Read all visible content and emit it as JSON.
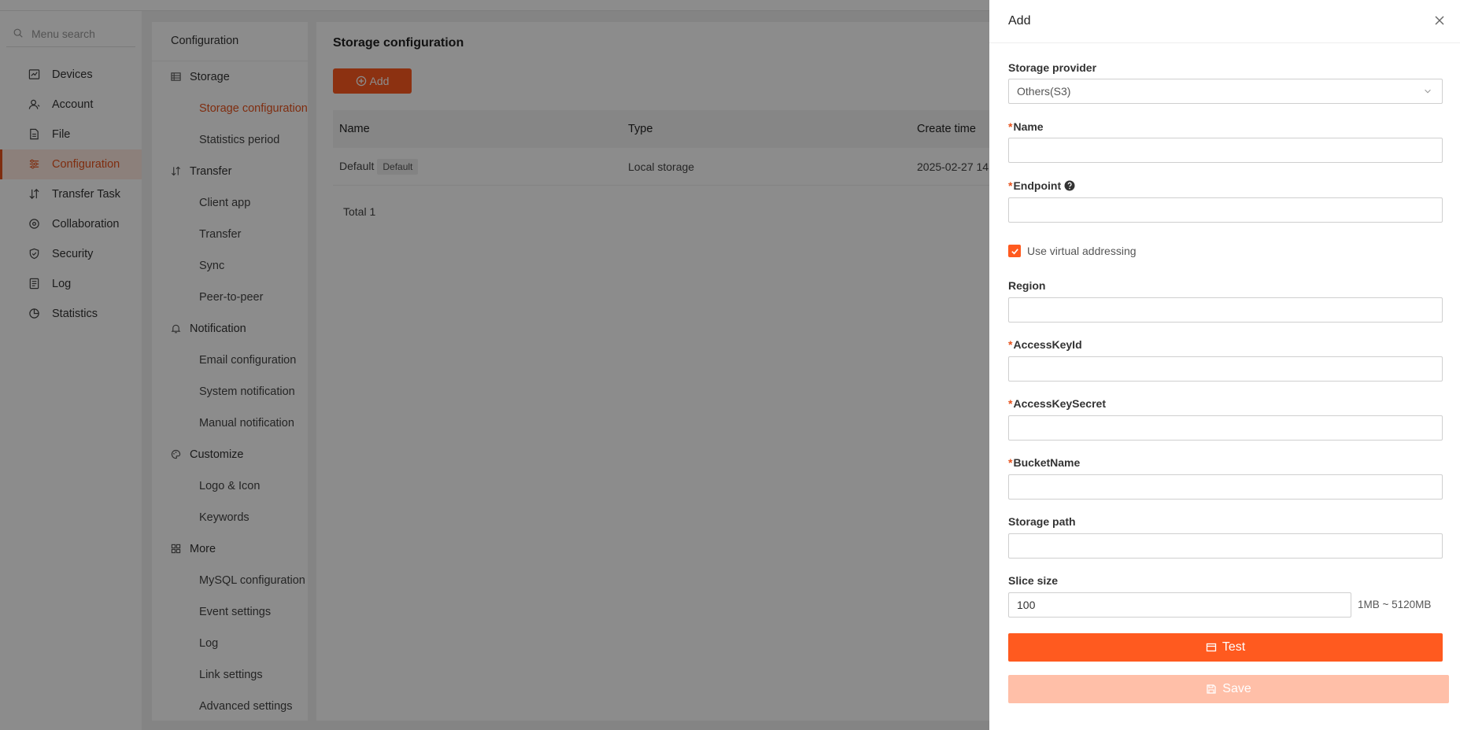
{
  "sidebar": {
    "search_placeholder": "Menu search",
    "items": [
      {
        "label": "Devices",
        "icon": "chart-icon"
      },
      {
        "label": "Account",
        "icon": "user-icon"
      },
      {
        "label": "File",
        "icon": "file-icon"
      },
      {
        "label": "Configuration",
        "icon": "sliders-icon",
        "active": true
      },
      {
        "label": "Transfer Task",
        "icon": "transfer-icon"
      },
      {
        "label": "Collaboration",
        "icon": "collaboration-icon"
      },
      {
        "label": "Security",
        "icon": "shield-icon"
      },
      {
        "label": "Log",
        "icon": "log-icon"
      },
      {
        "label": "Statistics",
        "icon": "pie-icon"
      }
    ]
  },
  "subnav": {
    "title": "Configuration",
    "groups": [
      {
        "label": "Storage",
        "icon": "storage-icon",
        "items": [
          "Storage configuration",
          "Statistics period"
        ]
      },
      {
        "label": "Transfer",
        "icon": "transfer-icon",
        "items": [
          "Client app",
          "Transfer",
          "Sync",
          "Peer-to-peer"
        ]
      },
      {
        "label": "Notification",
        "icon": "bell-icon",
        "items": [
          "Email configuration",
          "System notification",
          "Manual notification"
        ]
      },
      {
        "label": "Customize",
        "icon": "palette-icon",
        "items": [
          "Logo & Icon",
          "Keywords"
        ]
      },
      {
        "label": "More",
        "icon": "grid-icon",
        "items": [
          "MySQL configuration",
          "Event settings",
          "Log",
          "Link settings",
          "Advanced settings"
        ]
      }
    ],
    "active_item": "Storage configuration"
  },
  "content": {
    "title": "Storage configuration",
    "add_label": "Add",
    "columns": [
      "Name",
      "Type",
      "Create time"
    ],
    "rows": [
      {
        "name": "Default",
        "badge": "Default",
        "type": "Local storage",
        "create_time": "2025-02-27 14:"
      }
    ],
    "total": "Total 1"
  },
  "drawer": {
    "title": "Add",
    "storage_provider_label": "Storage provider",
    "storage_provider_value": "Others(S3)",
    "name_label": "Name",
    "endpoint_label": "Endpoint",
    "virtual_addressing_label": "Use virtual addressing",
    "virtual_addressing_checked": true,
    "region_label": "Region",
    "access_key_id_label": "AccessKeyId",
    "access_key_secret_label": "AccessKeySecret",
    "bucket_name_label": "BucketName",
    "storage_path_label": "Storage path",
    "slice_size_label": "Slice size",
    "slice_size_value": "100",
    "slice_size_range": "1MB ~ 5120MB",
    "test_label": "Test",
    "save_label": "Save",
    "required_mark": "*"
  },
  "colors": {
    "accent": "#ff5a1f",
    "accent_active_text": "#e8531d",
    "save_disabled": "#ffbfa8"
  }
}
